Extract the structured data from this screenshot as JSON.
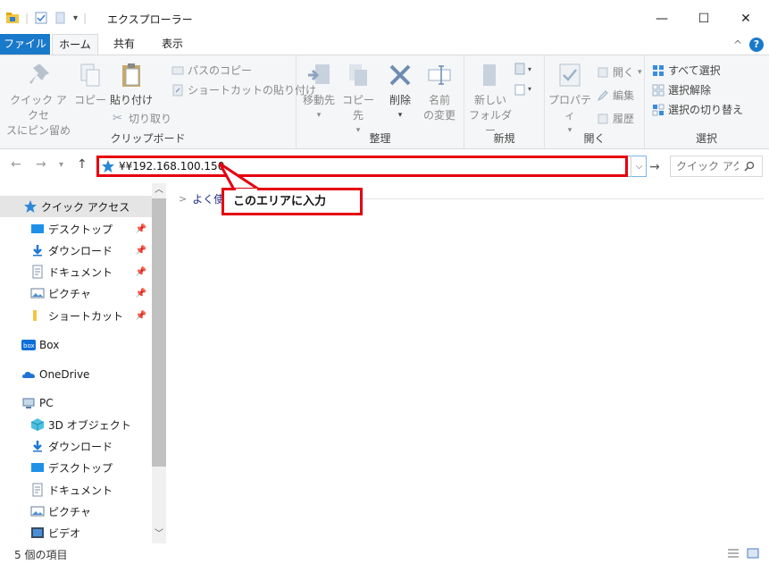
{
  "window": {
    "title": "エクスプローラー",
    "controls": {
      "minimize": "—",
      "maximize": "☐",
      "close": "✕"
    }
  },
  "ribbon_tabs": {
    "file": "ファイル",
    "home": "ホーム",
    "share": "共有",
    "view": "表示",
    "collapse": "^",
    "help": "?"
  },
  "ribbon": {
    "clipboard": {
      "label": "クリップボード",
      "pin_quick": "クイック アクセ\nスにピン留め",
      "pin_quick_line1": "クイック アクセ",
      "pin_quick_line2": "スにピン留め",
      "copy": "コピー",
      "paste": "貼り付け",
      "copy_path": "パスのコピー",
      "paste_shortcut": "ショートカットの貼り付け",
      "cut": "切り取り"
    },
    "organize": {
      "label": "整理",
      "move_to_line1": "移動先",
      "copy_to_line1": "コピー先",
      "delete": "削除",
      "rename_line1": "名前",
      "rename_line2": "の変更"
    },
    "new": {
      "label": "新規",
      "new_folder_line1": "新しい",
      "new_folder_line2": "フォルダー"
    },
    "open": {
      "label": "開く",
      "properties": "プロパティ",
      "open": "開く",
      "edit": "編集",
      "history": "履歴"
    },
    "select": {
      "label": "選択",
      "select_all": "すべて選択",
      "select_none": "選択解除",
      "invert": "選択の切り替え"
    }
  },
  "address": {
    "value": "¥¥192.168.100.150",
    "search_placeholder": "クイック アク..."
  },
  "annotation": {
    "callout": "このエリアに入力"
  },
  "nav_pane": {
    "quick_access": "クイック アクセス",
    "quick_items": [
      "デスクトップ",
      "ダウンロード",
      "ドキュメント",
      "ピクチャ",
      "ショートカット"
    ],
    "box": "Box",
    "onedrive": "OneDrive",
    "pc": "PC",
    "pc_items": [
      "3D オブジェクト",
      "ダウンロード",
      "デスクトップ",
      "ドキュメント",
      "ピクチャ",
      "ビデオ"
    ]
  },
  "content": {
    "group_header": "よく使用"
  },
  "status": {
    "item_count": "5 個の項目"
  },
  "colors": {
    "accent": "#1979ca",
    "annotation": "#e5000f",
    "ribbon_bg": "#f5f6f7"
  }
}
